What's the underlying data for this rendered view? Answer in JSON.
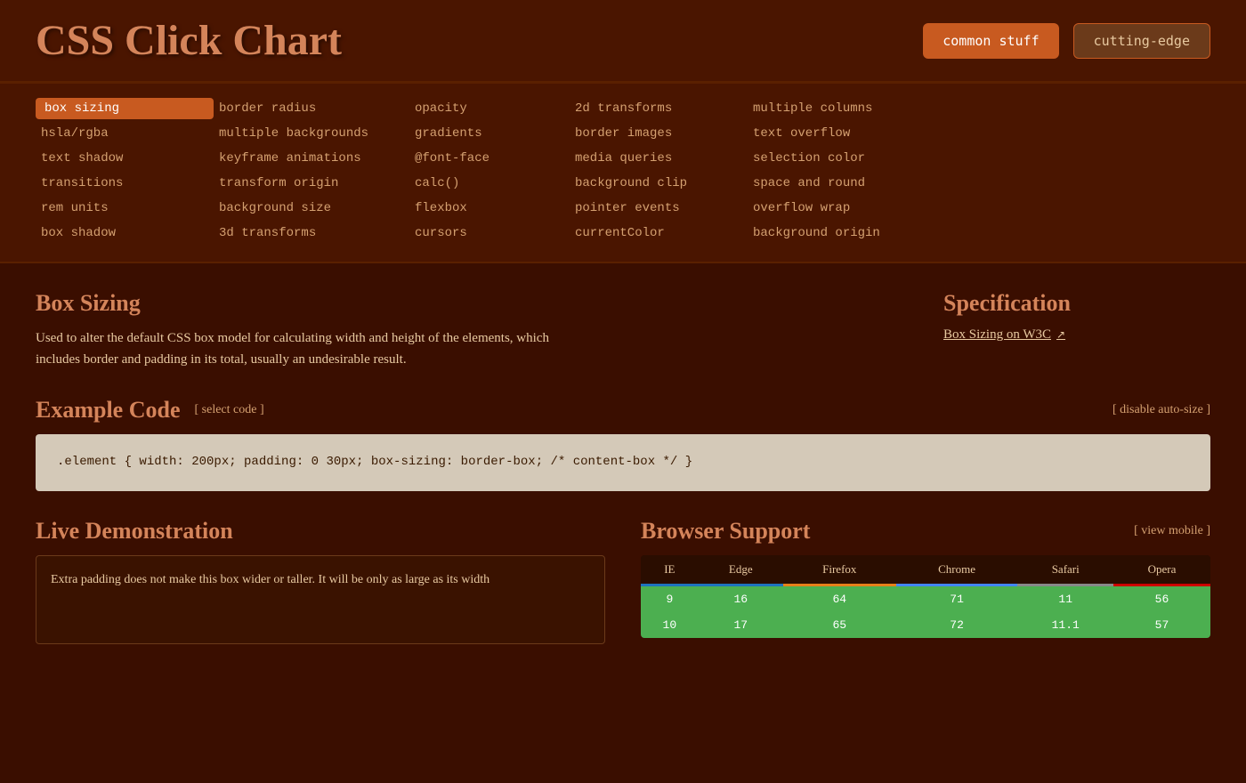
{
  "header": {
    "title": "CSS Click Chart",
    "btn_common": "common stuff",
    "btn_cutting": "cutting-edge"
  },
  "nav": {
    "items": [
      {
        "label": "box sizing",
        "active": true,
        "col": 0
      },
      {
        "label": "border radius",
        "active": false,
        "col": 1
      },
      {
        "label": "opacity",
        "active": false,
        "col": 2
      },
      {
        "label": "2d transforms",
        "active": false,
        "col": 3
      },
      {
        "label": "multiple columns",
        "active": false,
        "col": 4
      },
      {
        "label": "hsla/rgba",
        "active": false,
        "col": 0
      },
      {
        "label": "multiple backgrounds",
        "active": false,
        "col": 1
      },
      {
        "label": "gradients",
        "active": false,
        "col": 2
      },
      {
        "label": "border images",
        "active": false,
        "col": 3
      },
      {
        "label": "text overflow",
        "active": false,
        "col": 4
      },
      {
        "label": "text shadow",
        "active": false,
        "col": 0
      },
      {
        "label": "keyframe animations",
        "active": false,
        "col": 1
      },
      {
        "label": "@font-face",
        "active": false,
        "col": 2
      },
      {
        "label": "media queries",
        "active": false,
        "col": 3
      },
      {
        "label": "selection color",
        "active": false,
        "col": 4
      },
      {
        "label": "transitions",
        "active": false,
        "col": 0
      },
      {
        "label": "transform origin",
        "active": false,
        "col": 1
      },
      {
        "label": "calc()",
        "active": false,
        "col": 2
      },
      {
        "label": "background clip",
        "active": false,
        "col": 3
      },
      {
        "label": "space and round",
        "active": false,
        "col": 4
      },
      {
        "label": "rem units",
        "active": false,
        "col": 0
      },
      {
        "label": "background size",
        "active": false,
        "col": 1
      },
      {
        "label": "flexbox",
        "active": false,
        "col": 2
      },
      {
        "label": "pointer events",
        "active": false,
        "col": 3
      },
      {
        "label": "overflow wrap",
        "active": false,
        "col": 4
      },
      {
        "label": "box shadow",
        "active": false,
        "col": 0
      },
      {
        "label": "3d transforms",
        "active": false,
        "col": 1
      },
      {
        "label": "cursors",
        "active": false,
        "col": 2
      },
      {
        "label": "currentColor",
        "active": false,
        "col": 3
      },
      {
        "label": "background origin",
        "active": false,
        "col": 4
      }
    ]
  },
  "main": {
    "section_title": "Box Sizing",
    "section_desc": "Used to alter the default CSS box model for calculating width and height of the elements, which includes border and padding in its total, usually an undesirable result.",
    "spec_title": "Specification",
    "spec_link_text": "Box Sizing on W3C",
    "example_code_title": "Example Code",
    "select_code_label": "[ select code ]",
    "disable_auto_size": "[ disable auto-size ]",
    "code_lines": [
      ".element {",
      "  width: 200px;",
      "  padding: 0 30px;",
      "  box-sizing: border-box; /* content-box */",
      "}"
    ],
    "live_demo_title": "Live Demonstration",
    "demo_text": "Extra padding does not make this box wider or taller. It will be only as large as its width",
    "browser_support_title": "Browser Support",
    "view_mobile_label": "[ view mobile ]",
    "browser_columns": [
      "IE",
      "Edge",
      "Firefox",
      "Chrome",
      "Safari",
      "Opera"
    ],
    "browser_col_classes": [
      "col-ie",
      "col-edge",
      "col-firefox",
      "col-chrome",
      "col-safari",
      "col-opera"
    ],
    "browser_rows": [
      [
        "9",
        "16",
        "64",
        "71",
        "11",
        "56"
      ],
      [
        "10",
        "17",
        "65",
        "72",
        "11.1",
        "57"
      ]
    ]
  }
}
